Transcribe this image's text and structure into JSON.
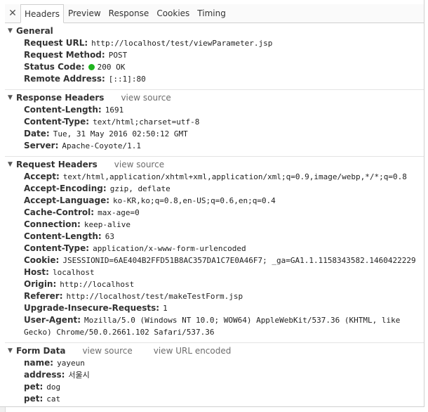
{
  "tabs": [
    "Headers",
    "Preview",
    "Response",
    "Cookies",
    "Timing"
  ],
  "general": {
    "title": "General",
    "rows": [
      {
        "key": "Request URL:",
        "val": "http://localhost/test/viewParameter.jsp"
      },
      {
        "key": "Request Method:",
        "val": "POST"
      },
      {
        "key": "Status Code:",
        "val": "200 OK"
      },
      {
        "key": "Remote Address:",
        "val": "[::1]:80"
      }
    ]
  },
  "response_headers": {
    "title": "Response Headers",
    "view_source": "view source",
    "rows": [
      {
        "key": "Content-Length:",
        "val": "1691"
      },
      {
        "key": "Content-Type:",
        "val": "text/html;charset=utf-8"
      },
      {
        "key": "Date:",
        "val": "Tue, 31 May 2016 02:50:12 GMT"
      },
      {
        "key": "Server:",
        "val": "Apache-Coyote/1.1"
      }
    ]
  },
  "request_headers": {
    "title": "Request Headers",
    "view_source": "view source",
    "rows": [
      {
        "key": "Accept:",
        "val": "text/html,application/xhtml+xml,application/xml;q=0.9,image/webp,*/*;q=0.8"
      },
      {
        "key": "Accept-Encoding:",
        "val": "gzip, deflate"
      },
      {
        "key": "Accept-Language:",
        "val": "ko-KR,ko;q=0.8,en-US;q=0.6,en;q=0.4"
      },
      {
        "key": "Cache-Control:",
        "val": "max-age=0"
      },
      {
        "key": "Connection:",
        "val": "keep-alive"
      },
      {
        "key": "Content-Length:",
        "val": "63"
      },
      {
        "key": "Content-Type:",
        "val": "application/x-www-form-urlencoded"
      },
      {
        "key": "Cookie:",
        "val": "JSESSIONID=6AE404B2FFD51B8AC357DA1C7E0A46F7; _ga=GA1.1.1158343582.1460422229"
      },
      {
        "key": "Host:",
        "val": "localhost"
      },
      {
        "key": "Origin:",
        "val": "http://localhost"
      },
      {
        "key": "Referer:",
        "val": "http://localhost/test/makeTestForm.jsp"
      },
      {
        "key": "Upgrade-Insecure-Requests:",
        "val": "1"
      },
      {
        "key": "User-Agent:",
        "val": "Mozilla/5.0 (Windows NT 10.0; WOW64) AppleWebKit/537.36 (KHTML, like Gecko) Chrome/50.0.2661.102 Safari/537.36"
      }
    ]
  },
  "form_data": {
    "title": "Form Data",
    "view_source": "view source",
    "view_url_encoded": "view URL encoded",
    "rows": [
      {
        "key": "name:",
        "val": "yayeun"
      },
      {
        "key": "address:",
        "val": "서울시"
      },
      {
        "key": "pet:",
        "val": "dog"
      },
      {
        "key": "pet:",
        "val": "cat"
      }
    ]
  },
  "colors": {
    "status_ok": "#1fb41f",
    "accent": "#2a6fdc"
  }
}
